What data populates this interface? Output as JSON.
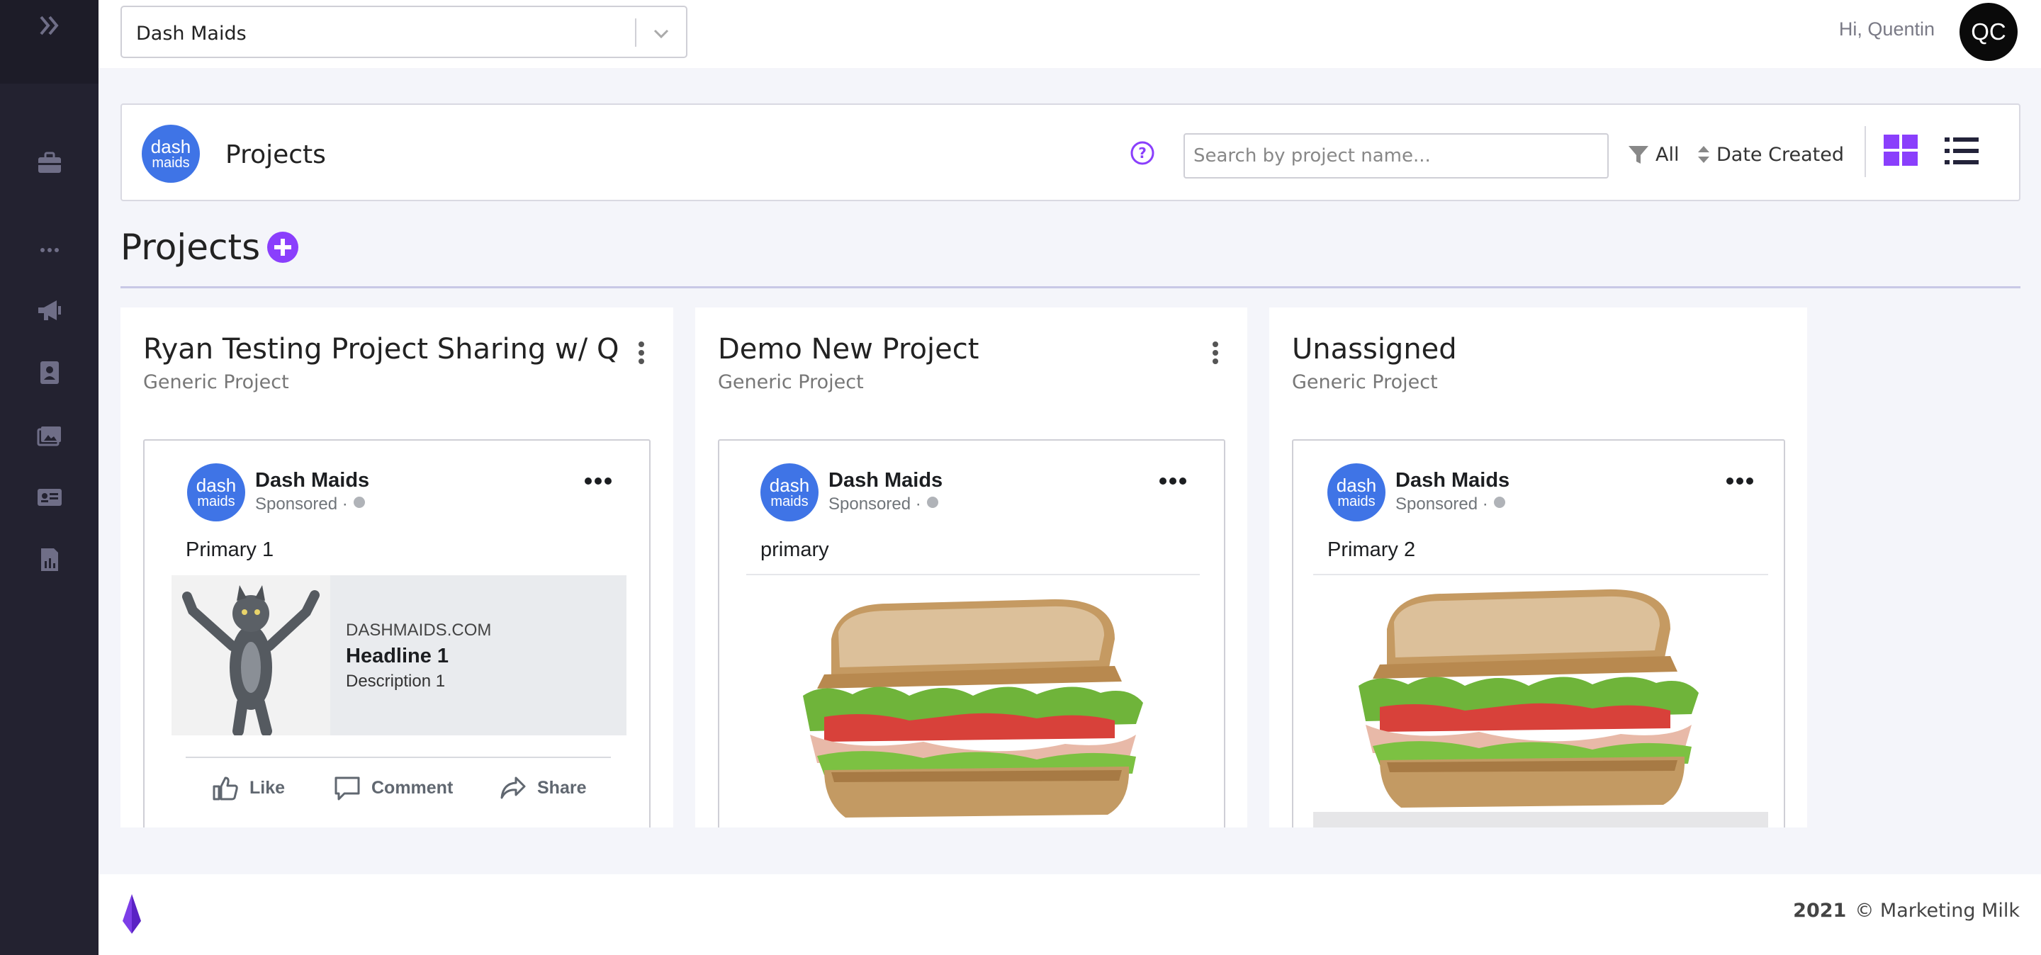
{
  "topbar": {
    "account_select": "Dash Maids",
    "greeting": "Hi, Quentin",
    "avatar_initials": "QC"
  },
  "sidebar": {
    "icons": [
      "expand-icon",
      "briefcase-icon",
      "more-dots-icon",
      "megaphone-icon",
      "contact-book-icon",
      "images-icon",
      "id-card-icon",
      "report-chart-icon"
    ]
  },
  "header": {
    "logo_line1": "dash",
    "logo_line2": "maids",
    "title": "Projects",
    "search_placeholder": "Search by project name...",
    "filter_label": "All",
    "sort_label": "Date Created"
  },
  "section": {
    "title": "Projects"
  },
  "projects": [
    {
      "title": "Ryan Testing Project Sharing w/ Q",
      "subtitle": "Generic Project",
      "ad": {
        "page_name": "Dash Maids",
        "sponsored": "Sponsored · ",
        "primary_text": "Primary 1",
        "domain": "DASHMAIDS.COM",
        "headline": "Headline 1",
        "description": "Description 1",
        "actions": [
          "Like",
          "Comment",
          "Share"
        ]
      }
    },
    {
      "title": "Demo New Project",
      "subtitle": "Generic Project",
      "ad": {
        "page_name": "Dash Maids",
        "sponsored": "Sponsored · ",
        "primary_text": "primary"
      }
    },
    {
      "title": "Unassigned",
      "subtitle": "Generic Project",
      "ad": {
        "page_name": "Dash Maids",
        "sponsored": "Sponsored · ",
        "primary_text": "Primary 2"
      }
    }
  ],
  "footer": {
    "year": "2021",
    "copyright": "© Marketing Milk"
  },
  "colors": {
    "accent_purple": "#8a3ffc",
    "brand_blue": "#3f74e6",
    "sidebar_bg": "#232230"
  }
}
